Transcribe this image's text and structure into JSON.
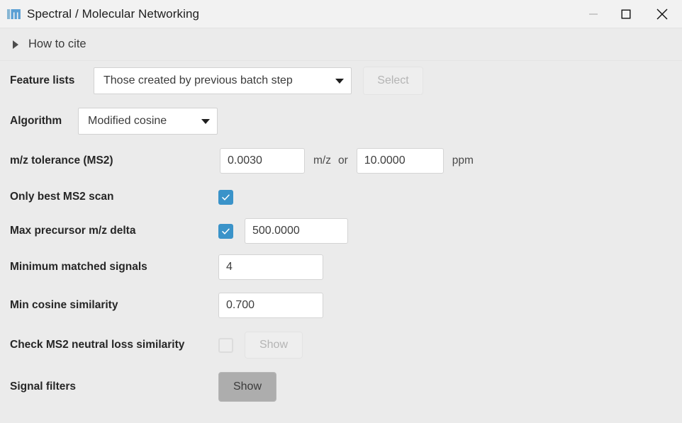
{
  "window": {
    "title": "Spectral / Molecular Networking",
    "app_icon": "mzmine-m-icon",
    "controls": {
      "minimize": "minimize-icon",
      "maximize": "maximize-icon",
      "close": "close-icon"
    }
  },
  "cite": {
    "label": "How to cite",
    "expand_icon": "triangle-right-icon",
    "expanded": false
  },
  "form": {
    "feature_lists": {
      "label": "Feature lists",
      "value": "Those created by previous batch step",
      "select_button": "Select",
      "select_disabled": true
    },
    "algorithm": {
      "label": "Algorithm",
      "value": "Modified cosine"
    },
    "mz_tolerance": {
      "label": "m/z tolerance (MS2)",
      "mz_value": "0.0030",
      "mz_unit": "m/z",
      "conjunction": "or",
      "ppm_value": "10.0000",
      "ppm_unit": "ppm"
    },
    "only_best_ms2": {
      "label": "Only best MS2 scan",
      "checked": true
    },
    "max_precursor_delta": {
      "label": "Max precursor m/z delta",
      "checked": true,
      "value": "500.0000"
    },
    "min_matched_signals": {
      "label": "Minimum matched signals",
      "value": "4"
    },
    "min_cosine_similarity": {
      "label": "Min cosine similarity",
      "value": "0.700"
    },
    "neutral_loss": {
      "label": "Check MS2 neutral loss similarity",
      "checked": false,
      "show_button": "Show",
      "show_disabled": true
    },
    "signal_filters": {
      "label": "Signal filters",
      "show_button": "Show",
      "show_disabled": false
    }
  },
  "colors": {
    "accent": "#3a93c9",
    "window_bg": "#ebebeb",
    "titlebar_bg": "#f2f2f2",
    "button_enabled": "#adadad"
  }
}
